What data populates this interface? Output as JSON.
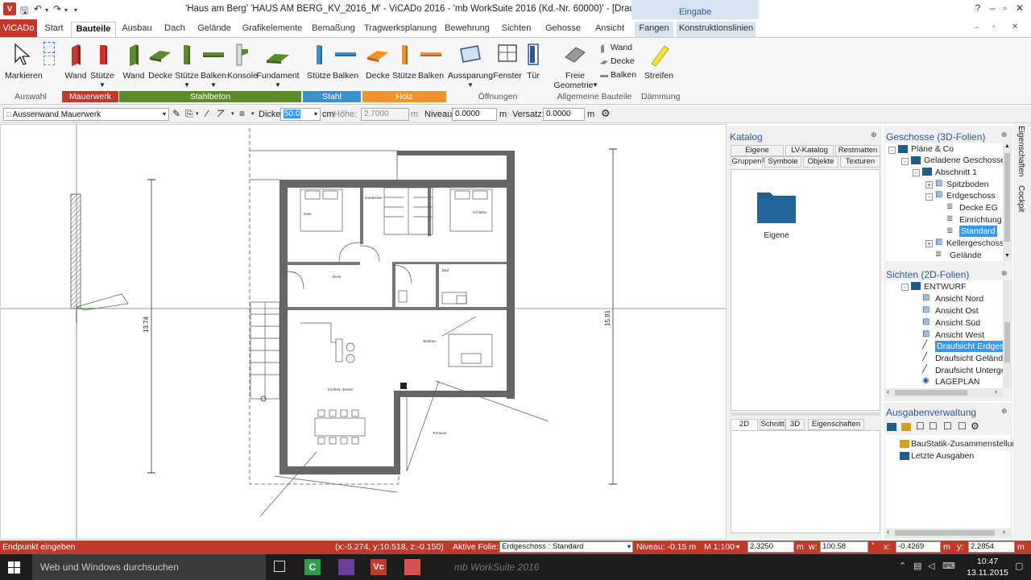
{
  "window": {
    "title": "'Haus am Berg' 'HAUS AM BERG_KV_2016_M' - ViCADo 2016 - 'mb WorkSuite 2016 (Kd.-Nr. 60000)' - [Draufsicht Erdgeschoss]",
    "context_tab": "Eingabe"
  },
  "tabs": [
    {
      "label": "ViCADo"
    },
    {
      "label": "Start"
    },
    {
      "label": "Bauteile"
    },
    {
      "label": "Ausbau"
    },
    {
      "label": "Dach"
    },
    {
      "label": "Gelände"
    },
    {
      "label": "Grafikelemente"
    },
    {
      "label": "Bemaßung"
    },
    {
      "label": "Tragwerksplanung"
    },
    {
      "label": "Bewehrung"
    },
    {
      "label": "Sichten"
    },
    {
      "label": "Gehosse"
    },
    {
      "label": "Ansicht"
    },
    {
      "label": "Fangen"
    },
    {
      "label": "Konstruktionslinien"
    }
  ],
  "ribbon": {
    "markieren": "Markieren",
    "mauerwerk": {
      "wand": "Wand",
      "stuetze": "Stütze"
    },
    "stahlbeton": {
      "wand": "Wand",
      "decke": "Decke",
      "stuetze": "Stütze",
      "balken": "Balken",
      "konsole": "Konsole",
      "fundament": "Fundament"
    },
    "stahl": {
      "stuetze": "Stütze",
      "balken": "Balken"
    },
    "holz": {
      "decke": "Decke",
      "stuetze": "Stütze",
      "balken": "Balken"
    },
    "oeffnungen": {
      "aussparung": "Aussparung",
      "fenster": "Fenster",
      "tuer": "Tür"
    },
    "allgemein": {
      "freie": "Freie",
      "geometrie": "Geometrie",
      "wand": "Wand",
      "decke": "Decke",
      "balken": "Balken"
    },
    "daemmung": {
      "streifen": "Streifen"
    },
    "groups": {
      "auswahl": "Auswahl",
      "mauerwerk": "Mauerwerk",
      "stahlbeton": "Stahlbeton",
      "stahl": "Stahl",
      "holz": "Holz",
      "oeffnungen": "Öffnungen",
      "allgemein": "Allgemeine Bauteile",
      "daemmung": "Dämmung"
    },
    "colors": {
      "mauerwerk": "#c0392b",
      "stahlbeton": "#5a8a2a",
      "stahl": "#3d8ec9",
      "holz": "#f0922b"
    }
  },
  "propbar": {
    "bauteil": "Aussenwand Mauerwerk",
    "dicke_label": "Dicke:",
    "dicke": "50.0",
    "dicke_unit": "cm",
    "hoehe_label": "Höhe:",
    "hoehe": "2.7000",
    "hoehe_unit": "m",
    "niveau_label": "Niveau:",
    "niveau": "0.0000",
    "niveau_unit": "m",
    "versatz_label": "Versatz:",
    "versatz": "0.0000",
    "versatz_unit": "m"
  },
  "drawing": {
    "dim_left": "13.74",
    "dim_right": "15.81",
    "rooms": {
      "room1": "Gast",
      "room2": "Gerderobe",
      "room3": "Schlafen",
      "room4": "Diele",
      "room5": "Bad",
      "room6": "Wohnen",
      "room7": "Kochen / Essen",
      "room8": "Terrasse"
    }
  },
  "katalog": {
    "title": "Katalog",
    "tabs_row1": [
      "Eigene Dateien",
      "LV-Katalog",
      "Restmatten"
    ],
    "tabs_row2": [
      "Gruppen",
      "Symbole",
      "Objekte",
      "Texturen"
    ],
    "folder": "Eigene",
    "bottom_tabs": [
      "2D",
      "Schnitt",
      "3D",
      "Eigenschaften"
    ]
  },
  "geschosse": {
    "title": "Geschosse (3D-Folien)",
    "items": [
      "Pläne & Co",
      "Geladene Geschosse",
      "Abschnitt 1",
      "Spitzboden",
      "Erdgeschoss",
      "Decke EG",
      "Einrichtung",
      "Standard",
      "Kellergeschoss",
      "Gelände"
    ]
  },
  "sichten": {
    "title": "Sichten (2D-Folien)",
    "items": [
      "ENTWURF",
      "Ansicht Nord",
      "Ansicht Ost",
      "Ansicht Süd",
      "Ansicht West",
      "Draufsicht Erdgeschoss",
      "Draufsicht Gelände",
      "Draufsicht Untergeschoss",
      "LAGEPLAN"
    ]
  },
  "ausgaben": {
    "title": "Ausgabenverwaltung",
    "items": [
      "BauStatik-Zusammenstellung",
      "Letzte Ausgaben"
    ]
  },
  "sidetabs": {
    "eigenschaften": "Eigenschaften",
    "cockpit": "Cockpit"
  },
  "status": {
    "prompt": "Endpunkt eingeben",
    "coords": "(x:-5.274, y:10.518, z:-0.150)",
    "folie_label": "Aktive Folie:",
    "folie": "Erdgeschoss : Standard",
    "niveau": "Niveau: -0.15 m",
    "massstab": "M 1:100",
    "a": "2.3250",
    "a_unit": "m",
    "w_label": "w:",
    "w": "100.58",
    "x_label": "x:",
    "x": "-0.4269",
    "x_unit": "m",
    "y_label": "y:",
    "y": "2.2854",
    "y_unit": "m"
  },
  "taskbar": {
    "search": "Web und Windows durchsuchen",
    "watermark": "mb WorkSuite 2016",
    "time": "10:47",
    "date": "13.11.2015"
  }
}
